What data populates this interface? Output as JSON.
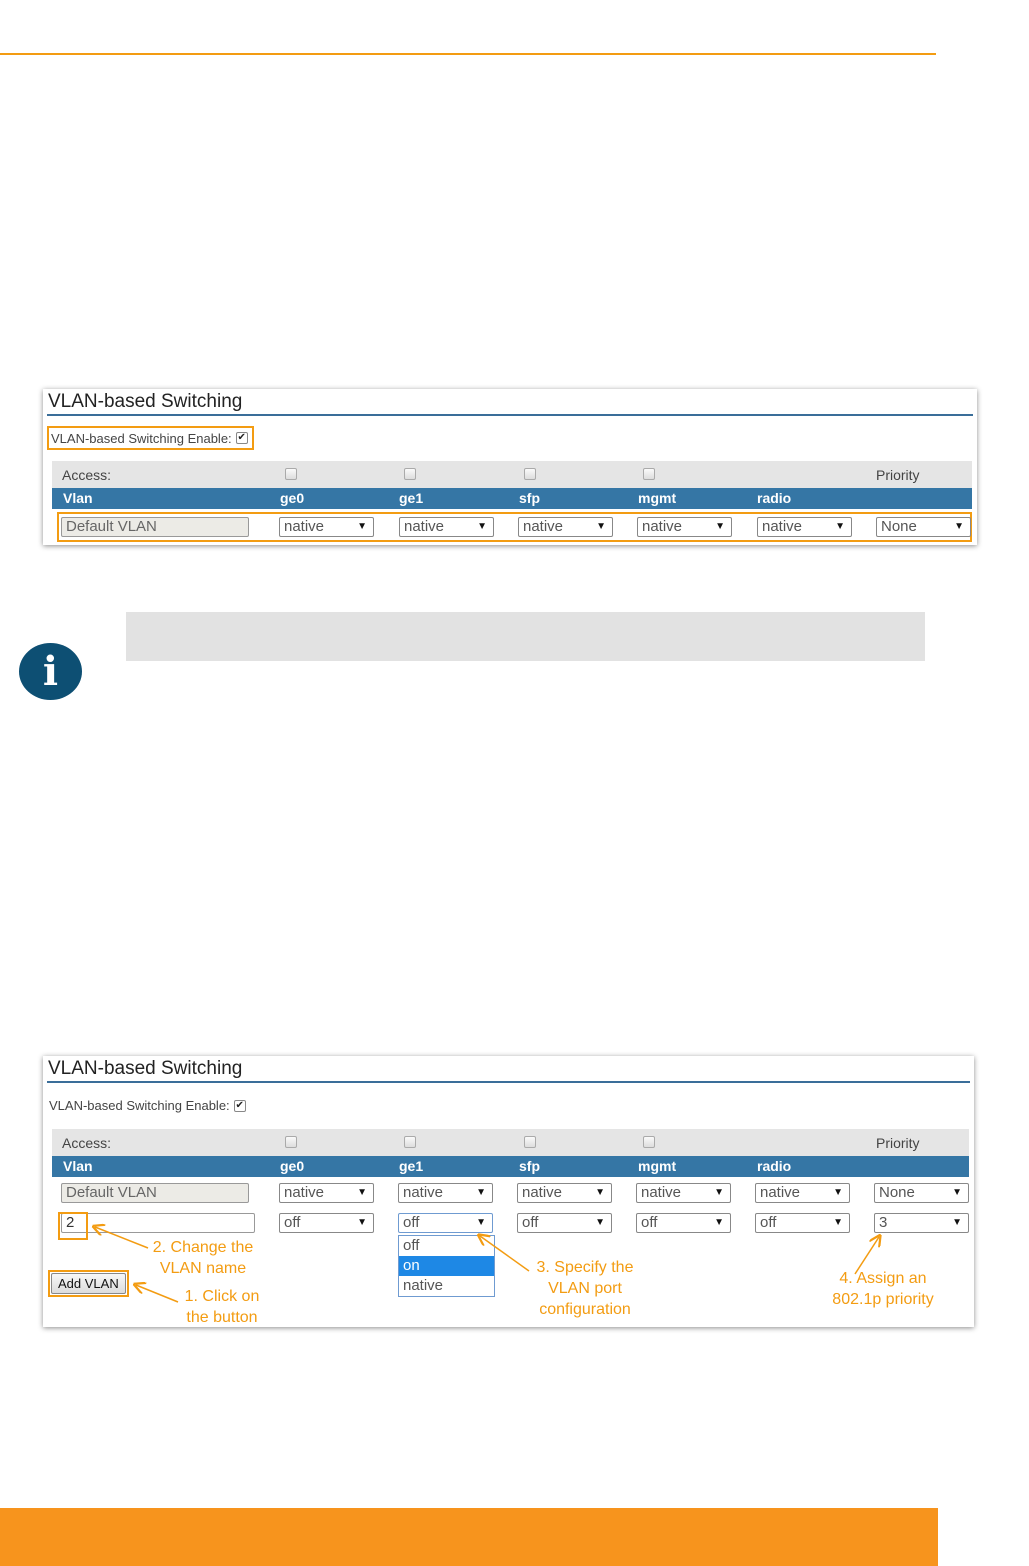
{
  "panel1": {
    "title": "VLAN-based Switching",
    "enable_label": "VLAN-based Switching Enable:",
    "enable_checked": true,
    "access_label": "Access:",
    "priority_label": "Priority",
    "columns": [
      "Vlan",
      "ge0",
      "ge1",
      "sfp",
      "mgmt",
      "radio"
    ],
    "row": {
      "name": "Default VLAN",
      "ports": [
        "native",
        "native",
        "native",
        "native",
        "native"
      ],
      "priority": "None"
    }
  },
  "panel2": {
    "title": "VLAN-based Switching",
    "enable_label": "VLAN-based Switching Enable:",
    "enable_checked": true,
    "access_label": "Access:",
    "priority_label": "Priority",
    "columns": [
      "Vlan",
      "ge0",
      "ge1",
      "sfp",
      "mgmt",
      "radio"
    ],
    "rows": [
      {
        "name": "Default VLAN",
        "ports": [
          "native",
          "native",
          "native",
          "native",
          "native"
        ],
        "priority": "None"
      },
      {
        "name": "2",
        "ports": [
          "off",
          "off",
          "off",
          "off",
          "off"
        ],
        "priority": "3"
      }
    ],
    "dropdown_options": [
      "off",
      "on",
      "native"
    ],
    "dropdown_selected": "on",
    "add_button": "Add VLAN",
    "annotations": {
      "a1": [
        "1. Click on",
        "the button"
      ],
      "a2": [
        "2. Change the",
        "VLAN name"
      ],
      "a3": [
        "3. Specify the",
        "VLAN port",
        "configuration"
      ],
      "a4": [
        "4. Assign an",
        "802.1p priority"
      ]
    }
  },
  "info_icon": "info-icon",
  "colors": {
    "accent": "#f39c12",
    "header": "#3576a5",
    "info": "#0d4f73",
    "footer": "#f7941d"
  },
  "check_glyph": "✔"
}
